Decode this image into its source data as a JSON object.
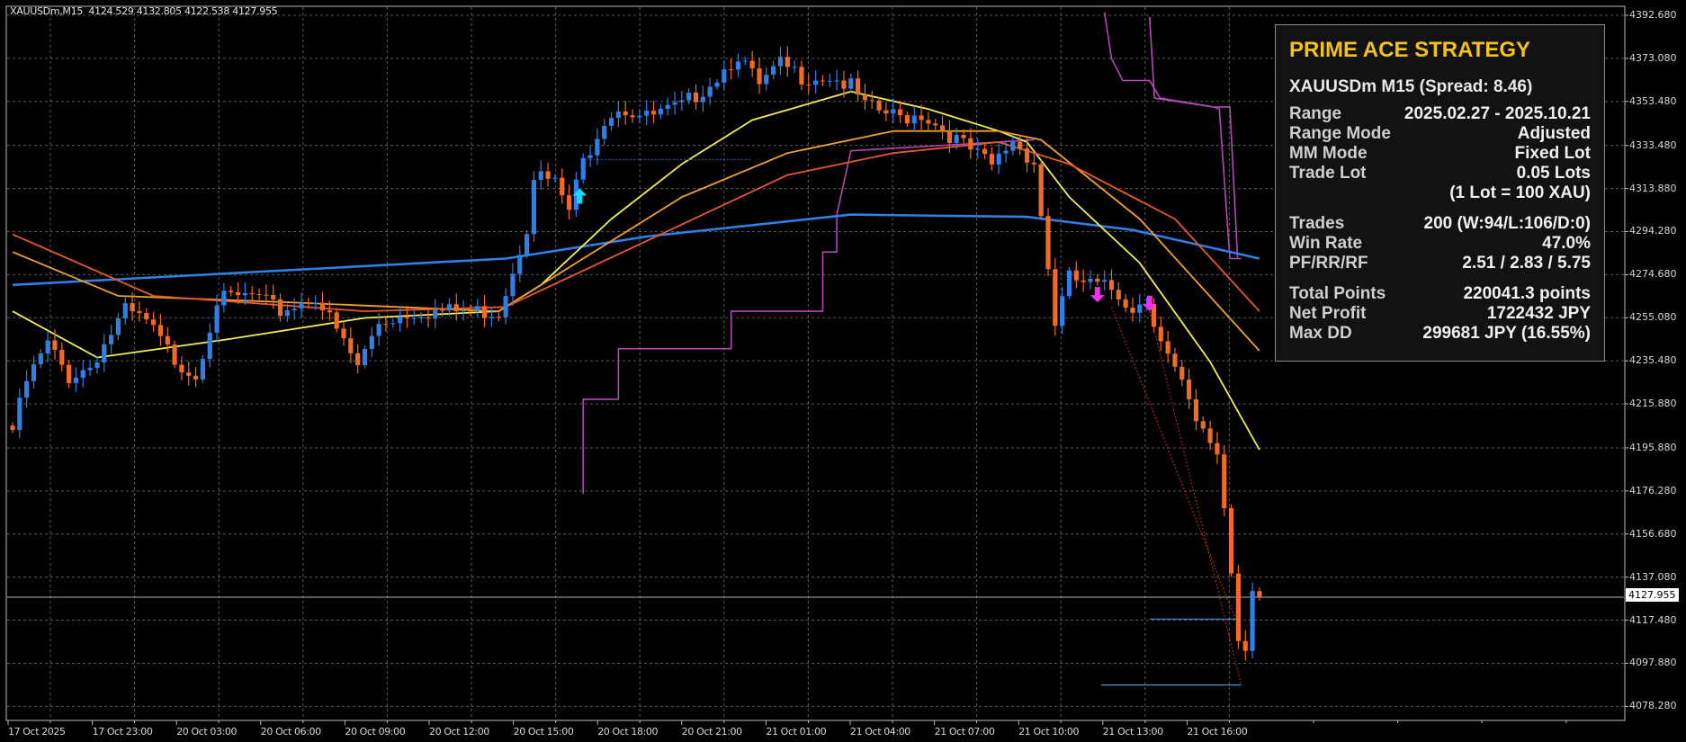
{
  "header": {
    "symbol": "XAUUSDm,M15",
    "ohlc": "4124.529 4132.805 4122.538 4127.955"
  },
  "panel": {
    "title": "PRIME ACE STRATEGY",
    "symbol_line": "XAUUSDm M15 (Spread: 8.46)",
    "rows": [
      {
        "k": "Range",
        "v": "2025.02.27 - 2025.10.21"
      },
      {
        "k": "Range Mode",
        "v": "Adjusted"
      },
      {
        "k": "MM Mode",
        "v": "Fixed Lot"
      },
      {
        "k": "Trade Lot",
        "v": "0.05 Lots"
      },
      {
        "k": "",
        "v": "(1 Lot = 100 XAU)"
      },
      {
        "k": "Trades",
        "v": "200 (W:94/L:106/D:0)"
      },
      {
        "k": "Win Rate",
        "v": "47.0%"
      },
      {
        "k": "PF/RR/RF",
        "v": "2.51 / 2.83 / 5.75"
      },
      {
        "k": "Total Points",
        "v": "220041.3 points"
      },
      {
        "k": "Net Profit",
        "v": "1722432 JPY"
      },
      {
        "k": "Max DD",
        "v": "299681 JPY (16.55%)"
      }
    ]
  },
  "colors": {
    "bull": "#2f7fe6",
    "bear": "#f06a28",
    "ma_slow": "#2f7fe6",
    "ma_fast": "#f2ee55",
    "ma_mid": "#f0a030",
    "ma_mid2": "#e8582a",
    "trail": "#b548b5",
    "buy_arrow": "#18d8f0",
    "sell_arrow": "#f030f0",
    "title": "#f4c21b"
  },
  "chart_data": {
    "type": "candlestick",
    "symbol": "XAUUSDm",
    "timeframe": "M15",
    "bars": 178,
    "current_price": "4127.955",
    "ylim": [
      4078.28,
      4392.68
    ],
    "y_ticks": [
      "4392.680",
      "4373.080",
      "4353.480",
      "4333.480",
      "4313.880",
      "4294.280",
      "4274.680",
      "4255.080",
      "4235.480",
      "4215.880",
      "4195.880",
      "4176.280",
      "4156.680",
      "4137.080",
      "4117.480",
      "4097.880",
      "4078.280"
    ],
    "x_ticks": [
      "17 Oct 2025",
      "17 Oct 23:00",
      "20 Oct 03:00",
      "20 Oct 06:00",
      "20 Oct 09:00",
      "20 Oct 12:00",
      "20 Oct 15:00",
      "20 Oct 18:00",
      "20 Oct 21:00",
      "21 Oct 01:00",
      "21 Oct 04:00",
      "21 Oct 07:00",
      "21 Oct 10:00",
      "21 Oct 13:00",
      "21 Oct 16:00"
    ],
    "close_path": [
      [
        0,
        4204
      ],
      [
        2,
        4226
      ],
      [
        5,
        4243
      ],
      [
        8,
        4228
      ],
      [
        11,
        4233
      ],
      [
        16,
        4258
      ],
      [
        19,
        4253
      ],
      [
        23,
        4236
      ],
      [
        26,
        4229
      ],
      [
        29,
        4263
      ],
      [
        34,
        4265
      ],
      [
        38,
        4258
      ],
      [
        43,
        4265
      ],
      [
        49,
        4233
      ],
      [
        52,
        4253
      ],
      [
        57,
        4258
      ],
      [
        63,
        4258
      ],
      [
        69,
        4258
      ],
      [
        71,
        4277
      ],
      [
        73,
        4297
      ],
      [
        74,
        4321
      ],
      [
        77,
        4316
      ],
      [
        79,
        4304
      ],
      [
        81,
        4326
      ],
      [
        84,
        4346
      ],
      [
        86,
        4351
      ],
      [
        90,
        4346
      ],
      [
        95,
        4351
      ],
      [
        100,
        4365
      ],
      [
        103,
        4375
      ],
      [
        106,
        4360
      ],
      [
        109,
        4370
      ],
      [
        112,
        4365
      ],
      [
        116,
        4365
      ],
      [
        119,
        4360
      ],
      [
        121,
        4351
      ],
      [
        126,
        4346
      ],
      [
        129,
        4348
      ],
      [
        132,
        4341
      ],
      [
        136,
        4331
      ],
      [
        139,
        4324
      ],
      [
        142,
        4336
      ],
      [
        145,
        4326
      ],
      [
        146,
        4302
      ],
      [
        148,
        4253
      ],
      [
        150,
        4273
      ],
      [
        153,
        4270
      ],
      [
        156,
        4268
      ],
      [
        159,
        4260
      ],
      [
        161,
        4263
      ],
      [
        164,
        4238
      ],
      [
        166,
        4224
      ],
      [
        168,
        4206
      ],
      [
        171,
        4194
      ],
      [
        172,
        4169
      ],
      [
        174,
        4110
      ],
      [
        175,
        4105
      ],
      [
        176,
        4134
      ],
      [
        177,
        4127.955
      ]
    ],
    "moving_averages": [
      {
        "name": "slow",
        "color_key": "ma_slow",
        "points": [
          [
            0,
            4270
          ],
          [
            70,
            4282
          ],
          [
            90,
            4292
          ],
          [
            119,
            4302
          ],
          [
            144,
            4301
          ],
          [
            159,
            4295
          ],
          [
            177,
            4282
          ]
        ]
      },
      {
        "name": "fast",
        "color_key": "ma_fast",
        "points": [
          [
            0,
            4258
          ],
          [
            12,
            4237
          ],
          [
            30,
            4245
          ],
          [
            50,
            4255
          ],
          [
            69,
            4258
          ],
          [
            75,
            4270
          ],
          [
            85,
            4300
          ],
          [
            95,
            4325
          ],
          [
            105,
            4345
          ],
          [
            119,
            4358
          ],
          [
            130,
            4350
          ],
          [
            140,
            4340
          ],
          [
            144,
            4335
          ],
          [
            150,
            4310
          ],
          [
            160,
            4280
          ],
          [
            170,
            4235
          ],
          [
            177,
            4195
          ]
        ]
      },
      {
        "name": "mid",
        "color_key": "ma_mid",
        "points": [
          [
            0,
            4285
          ],
          [
            15,
            4265
          ],
          [
            40,
            4262
          ],
          [
            69,
            4258
          ],
          [
            80,
            4280
          ],
          [
            95,
            4310
          ],
          [
            110,
            4330
          ],
          [
            125,
            4340
          ],
          [
            140,
            4340
          ],
          [
            146,
            4336
          ],
          [
            160,
            4300
          ],
          [
            177,
            4240
          ]
        ]
      },
      {
        "name": "mid2",
        "color_key": "ma_mid2",
        "points": [
          [
            0,
            4293
          ],
          [
            20,
            4265
          ],
          [
            50,
            4258
          ],
          [
            70,
            4260
          ],
          [
            90,
            4290
          ],
          [
            110,
            4320
          ],
          [
            125,
            4330
          ],
          [
            140,
            4335
          ],
          [
            150,
            4325
          ],
          [
            165,
            4300
          ],
          [
            177,
            4258
          ]
        ]
      }
    ],
    "trail_lines": [
      [
        [
          81,
          4175
        ],
        [
          81,
          4218
        ],
        [
          86,
          4218
        ],
        [
          86,
          4241
        ],
        [
          102,
          4241
        ],
        [
          102,
          4258
        ],
        [
          115,
          4258
        ],
        [
          115,
          4285
        ],
        [
          117,
          4285
        ],
        [
          117,
          4302
        ],
        [
          119,
          4331
        ],
        [
          145,
          4336
        ]
      ],
      [
        [
          155,
          4394
        ],
        [
          156,
          4373
        ],
        [
          157.6,
          4363
        ],
        [
          161.4,
          4363
        ],
        [
          162.9,
          4355
        ],
        [
          170.5,
          4351
        ],
        [
          171.3,
          4350
        ],
        [
          172.8,
          4282
        ],
        [
          174.4,
          4282
        ]
      ],
      [
        [
          161.4,
          4392
        ],
        [
          162.1,
          4355
        ],
        [
          170.5,
          4351
        ],
        [
          172.8,
          4351
        ],
        [
          173.9,
          4282
        ]
      ]
    ],
    "signals": [
      {
        "type": "buy",
        "bar": 80.5,
        "price": 4309
      },
      {
        "type": "sell",
        "bar": 154,
        "price": 4267
      },
      {
        "type": "sell",
        "bar": 161.4,
        "price": 4263
      }
    ],
    "trades": [
      {
        "from": [
          156,
          4260
        ],
        "to": [
          173.6,
          4118
        ]
      },
      {
        "from": [
          161.4,
          4258
        ],
        "to": [
          174.4,
          4088
        ]
      }
    ],
    "levels": [
      {
        "price": 4118,
        "from": 161.4,
        "to": 173.6
      },
      {
        "price": 4088,
        "from": 154.5,
        "to": 174.4
      },
      {
        "price": 4327,
        "from": 81,
        "to": 105,
        "dotted": true
      }
    ]
  }
}
